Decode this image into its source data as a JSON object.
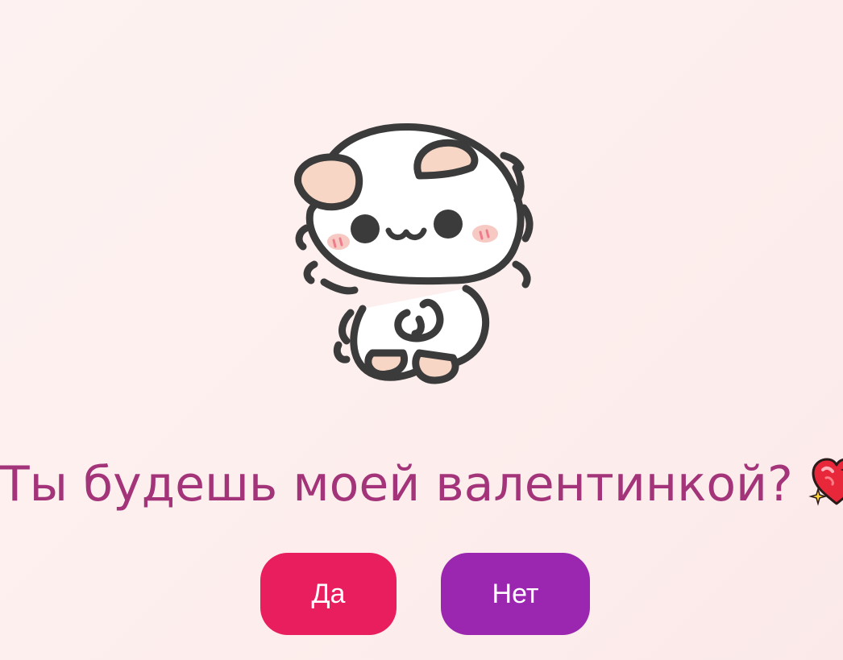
{
  "question": {
    "text": "Ты будешь моей валентинкой?"
  },
  "buttons": {
    "yes_label": "Да",
    "no_label": "Нет"
  },
  "illustration": {
    "subject": "cute-cat-sticker",
    "icon": "sparkling-heart-icon"
  },
  "colors": {
    "background": "#fdf0ef",
    "question_text": "#a4347a",
    "yes_button": "#e91e5e",
    "no_button": "#9b27b0",
    "button_text": "#ffffff"
  }
}
